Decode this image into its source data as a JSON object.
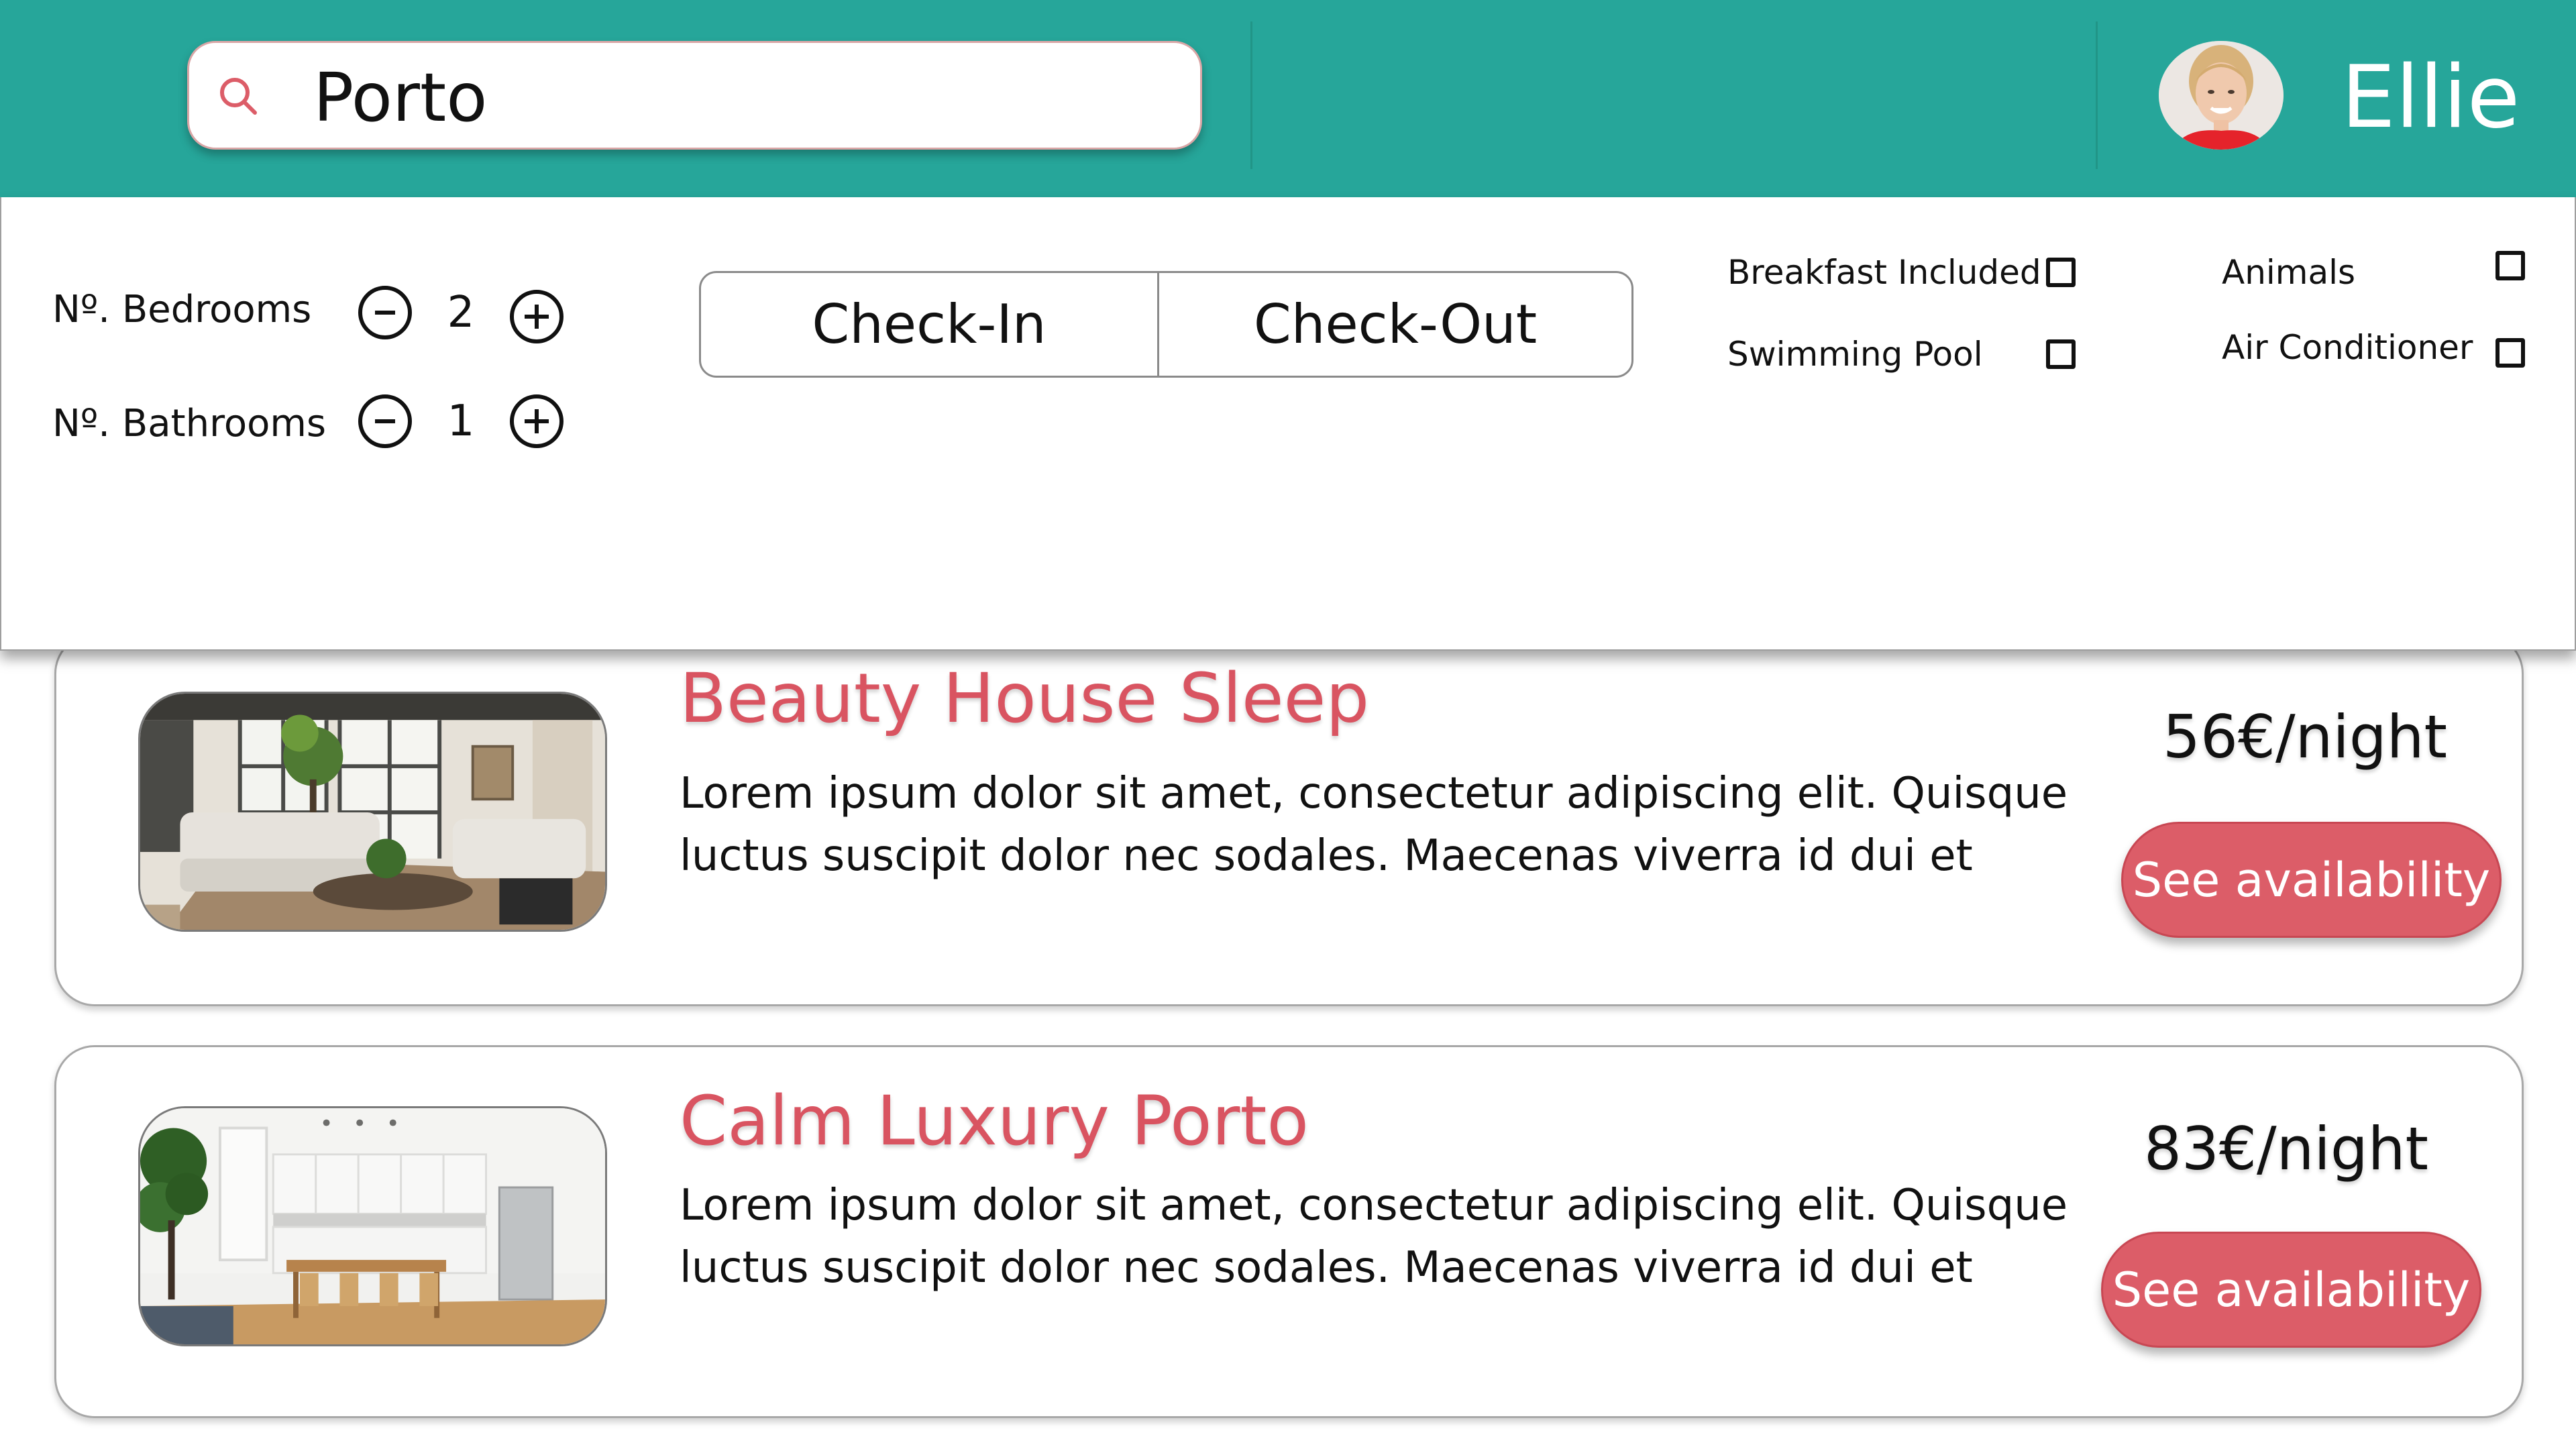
{
  "colors": {
    "header_bg": "#26a69a",
    "accent": "#dc5d68",
    "title": "#d95461",
    "text": "#111111"
  },
  "header": {
    "search": {
      "value": "Porto",
      "icon": "search-icon"
    },
    "user": {
      "name": "Ellie",
      "avatar_icon": "avatar-photo"
    }
  },
  "filters": {
    "bedrooms": {
      "label": "Nº. Bedrooms",
      "value": "2"
    },
    "bathrooms": {
      "label": "Nº. Bathrooms",
      "value": "1"
    },
    "dates": {
      "check_in": "Check-In",
      "check_out": "Check-Out"
    },
    "amenities": [
      {
        "label": "Breakfast Included",
        "checked": false
      },
      {
        "label": "Swimming Pool",
        "checked": false
      },
      {
        "label": "Animals",
        "checked": false
      },
      {
        "label": "Air Conditioner",
        "checked": false
      }
    ]
  },
  "listings": [
    {
      "title": "Beauty House Sleep",
      "description": "Lorem ipsum dolor sit amet, consectetur adipiscing elit. Quisque luctus suscipit dolor nec sodales. Maecenas viverra id dui et",
      "price": "56€/night",
      "button": "See availability",
      "photo": "living-room-photo"
    },
    {
      "title": "Calm Luxury Porto",
      "description": "Lorem ipsum dolor sit amet, consectetur adipiscing elit. Quisque luctus suscipit dolor nec sodales. Maecenas viverra id dui et",
      "price": "83€/night",
      "button": "See availability",
      "photo": "kitchen-photo"
    }
  ]
}
